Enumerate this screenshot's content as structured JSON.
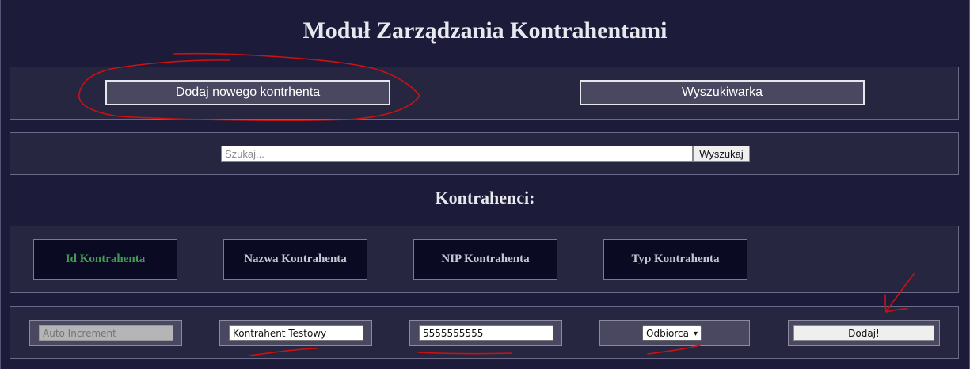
{
  "page": {
    "title": "Moduł Zarządzania Kontrahentami",
    "subtitle": "Kontrahenci:"
  },
  "nav": {
    "add_button": "Dodaj nowego kontrhenta",
    "search_button": "Wyszukiwarka"
  },
  "search": {
    "placeholder": "Szukaj...",
    "value": "",
    "button": "Wyszukaj"
  },
  "table": {
    "columns": [
      "Id Kontrahenta",
      "Nazwa Kontrahenta",
      "NIP Kontrahenta",
      "Typ Kontrahenta"
    ],
    "active_column_color": "#3f9e4f"
  },
  "form": {
    "id_placeholder": "Auto Increment",
    "name_value": "Kontrahent Testowy",
    "nip_value": "5555555555",
    "type_selected": "Odbiorca",
    "submit": "Dodaj!"
  },
  "annotation_color": "#cc1111"
}
